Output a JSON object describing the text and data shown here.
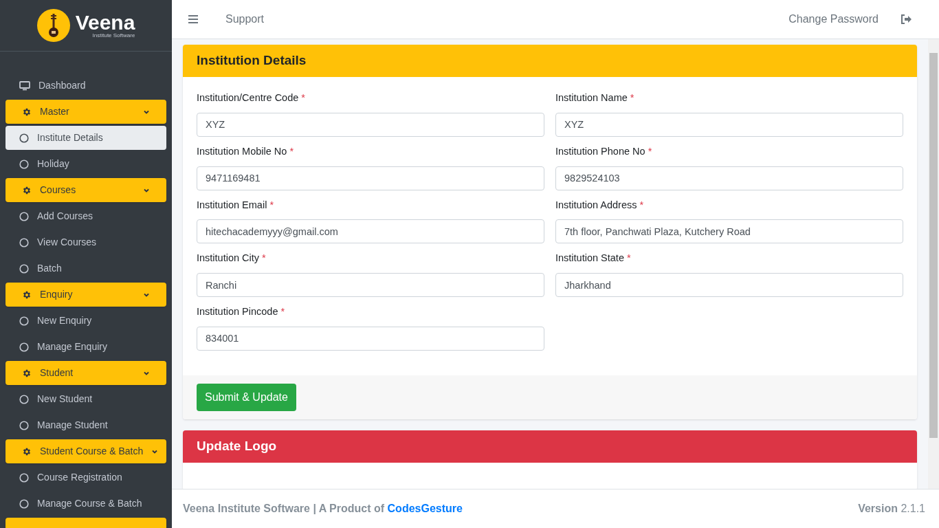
{
  "brand": {
    "name": "Veena",
    "tagline": "Institute Software"
  },
  "sidebar": {
    "items": [
      {
        "kind": "top",
        "label": "Dashboard",
        "selected": false
      },
      {
        "kind": "group",
        "label": "Master",
        "expanded": true
      },
      {
        "kind": "link",
        "label": "Institute Details",
        "selected": true
      },
      {
        "kind": "link",
        "label": "Holiday",
        "selected": false
      },
      {
        "kind": "group",
        "label": "Courses",
        "expanded": true
      },
      {
        "kind": "link",
        "label": "Add Courses",
        "selected": false
      },
      {
        "kind": "link",
        "label": "View Courses",
        "selected": false
      },
      {
        "kind": "link",
        "label": "Batch",
        "selected": false
      },
      {
        "kind": "group",
        "label": "Enquiry",
        "expanded": true
      },
      {
        "kind": "link",
        "label": "New Enquiry",
        "selected": false
      },
      {
        "kind": "link",
        "label": "Manage Enquiry",
        "selected": false
      },
      {
        "kind": "group",
        "label": "Student",
        "expanded": true
      },
      {
        "kind": "link",
        "label": "New Student",
        "selected": false
      },
      {
        "kind": "link",
        "label": "Manage Student",
        "selected": false
      },
      {
        "kind": "group",
        "label": "Student Course & Batch",
        "expanded": true
      },
      {
        "kind": "link",
        "label": "Course Registration",
        "selected": false
      },
      {
        "kind": "link",
        "label": "Manage Course & Batch",
        "selected": false
      },
      {
        "kind": "group"
      }
    ]
  },
  "topbar": {
    "support": "Support",
    "change_password": "Change Password"
  },
  "institution_card": {
    "title": "Institution Details",
    "fields": [
      {
        "label": "Institution/Centre Code",
        "required_mark": "*",
        "value": "XYZ"
      },
      {
        "label": "Institution Name",
        "required_mark": "*",
        "value": "XYZ"
      },
      {
        "label": "Institution Mobile No",
        "required_mark": "*",
        "value": "9471169481"
      },
      {
        "label": "Institution Phone No",
        "required_mark": "*",
        "value": "9829524103"
      },
      {
        "label": "Institution Email",
        "required_mark": "*",
        "value": "hitechacademyyy@gmail.com"
      },
      {
        "label": "Institution Address",
        "required_mark": "*",
        "value": "7th floor, Panchwati Plaza, Kutchery Road"
      },
      {
        "label": "Institution City",
        "required_mark": "*",
        "value": "Ranchi"
      },
      {
        "label": "Institution State",
        "required_mark": "*",
        "value": "Jharkhand"
      },
      {
        "label": "Institution Pincode",
        "required_mark": "*",
        "value": "834001"
      }
    ],
    "submit": "Submit & Update"
  },
  "logo_card": {
    "title": "Update Logo"
  },
  "footer": {
    "text": "Veena Institute Software | A Product of ",
    "link": "CodesGesture",
    "version": "**Version** 2.1.1"
  }
}
